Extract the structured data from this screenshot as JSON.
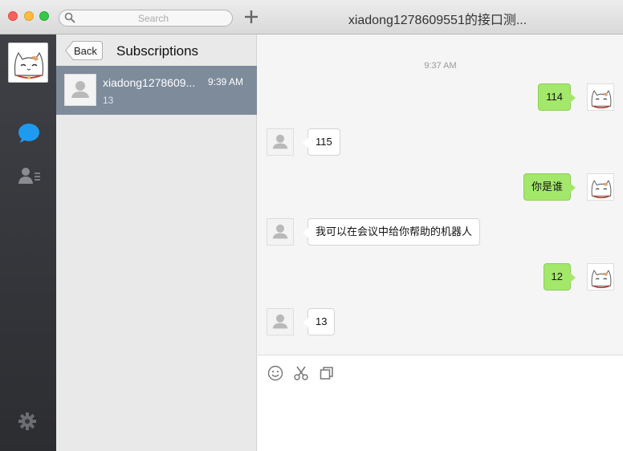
{
  "window": {
    "title": "xiadong1278609551的接口测..."
  },
  "search": {
    "placeholder": "Search"
  },
  "subscriptions": {
    "back_label": "Back",
    "title": "Subscriptions",
    "items": [
      {
        "name": "xiadong1278609...",
        "time": "9:39 AM",
        "preview": "13"
      }
    ]
  },
  "chat": {
    "timestamp": "9:37 AM",
    "messages": [
      {
        "direction": "out",
        "text": "114"
      },
      {
        "direction": "in",
        "text": "115"
      },
      {
        "direction": "out",
        "text": "你是谁"
      },
      {
        "direction": "in",
        "text": "我可以在会议中给你帮助的机器人"
      },
      {
        "direction": "out",
        "text": "12"
      },
      {
        "direction": "in",
        "text": "13"
      }
    ]
  },
  "icons": {
    "rail": [
      "chat-icon",
      "contacts-icon",
      "settings-icon"
    ],
    "composer": [
      "emoji-icon",
      "scissors-icon",
      "screenshot-icon"
    ]
  },
  "colors": {
    "outgoing_bubble": "#a3e86b",
    "selected_item": "#7d8b9b",
    "rail_background": "#35373c",
    "chat_icon": "#1e9bf0"
  }
}
